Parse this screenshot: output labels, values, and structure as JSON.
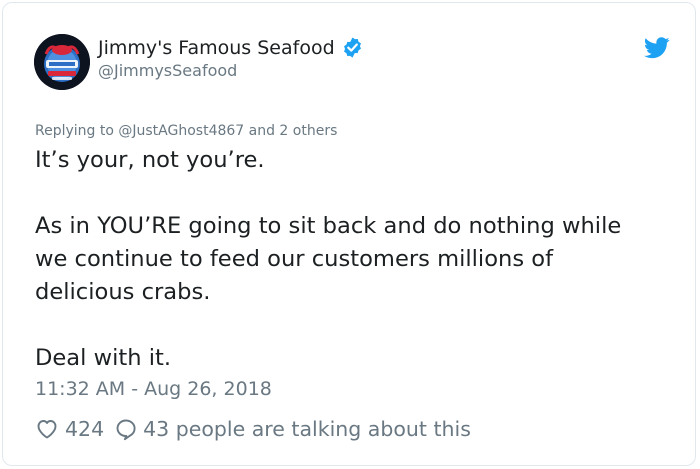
{
  "author": {
    "display_name": "Jimmy's Famous Seafood",
    "handle": "@JimmysSeafood",
    "avatar_icon": "jimmys-logo-avatar",
    "verified_icon": "verified-badge-icon",
    "verified_color": "#1da1f2"
  },
  "brand": {
    "logo_icon": "twitter-bird-icon",
    "color": "#1da1f2"
  },
  "reply": {
    "text": "Replying to @JustAGhost4867 and 2 others"
  },
  "tweet": {
    "paragraphs": [
      "It’s your, not you’re.",
      "As in YOU’RE going to sit back and do nothing while",
      "we continue to feed our customers millions of",
      "delicious crabs.",
      "Deal with it."
    ]
  },
  "timestamp": "11:32 AM - Aug 26, 2018",
  "engagement": {
    "likes": "424",
    "like_icon": "heart-icon",
    "comment_icon": "speech-bubble-icon",
    "talking_text": "43 people are talking about this"
  }
}
